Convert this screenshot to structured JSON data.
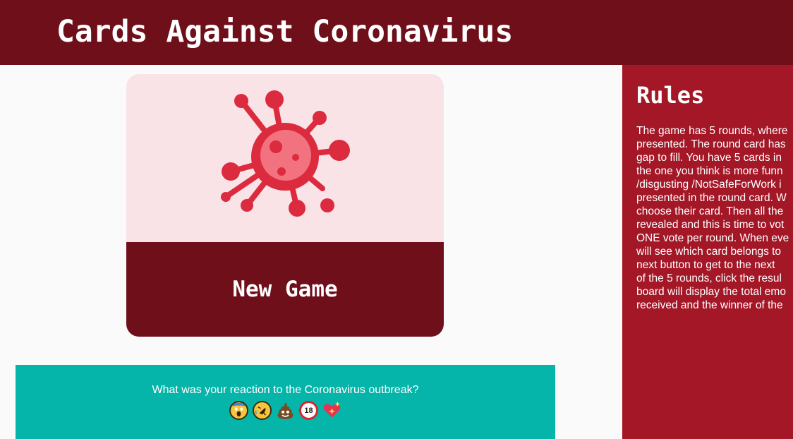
{
  "header": {
    "title": "Cards Against Coronavirus"
  },
  "new_game_card": {
    "label": "New Game",
    "icon": "virus-icon"
  },
  "poll": {
    "question": "What was your reaction to the Coronavirus outbreak?",
    "reactions": [
      {
        "icon": "screaming-face-icon",
        "glyph": ""
      },
      {
        "icon": "rofl-face-icon",
        "glyph": ""
      },
      {
        "icon": "poop-icon",
        "glyph": ""
      },
      {
        "icon": "no-under-18-icon",
        "glyph": "18"
      },
      {
        "icon": "sparkling-heart-icon",
        "glyph": ""
      }
    ]
  },
  "rules": {
    "title": "Rules",
    "lines": [
      "The game has 5 rounds, where",
      "presented. The round card has",
      "gap to fill. You have 5 cards in",
      "the one you think is more funn",
      "/disgusting /NotSafeForWork i",
      "presented in the round card. W",
      "choose their card. Then all the",
      "revealed and this is time to vot",
      "ONE vote per round. When eve",
      "will see which card belongs to",
      "next button to get to the next",
      "of the 5 rounds, click the resul",
      "board will display the total emo",
      "received and the winner of the"
    ]
  },
  "colors": {
    "header_bg": "#6e0f1a",
    "card_top_bg": "#fae3e6",
    "virus_red": "#dc2a3f",
    "virus_core": "#f2737f",
    "poll_bg": "#06b5a9",
    "rules_bg": "#a31727"
  }
}
